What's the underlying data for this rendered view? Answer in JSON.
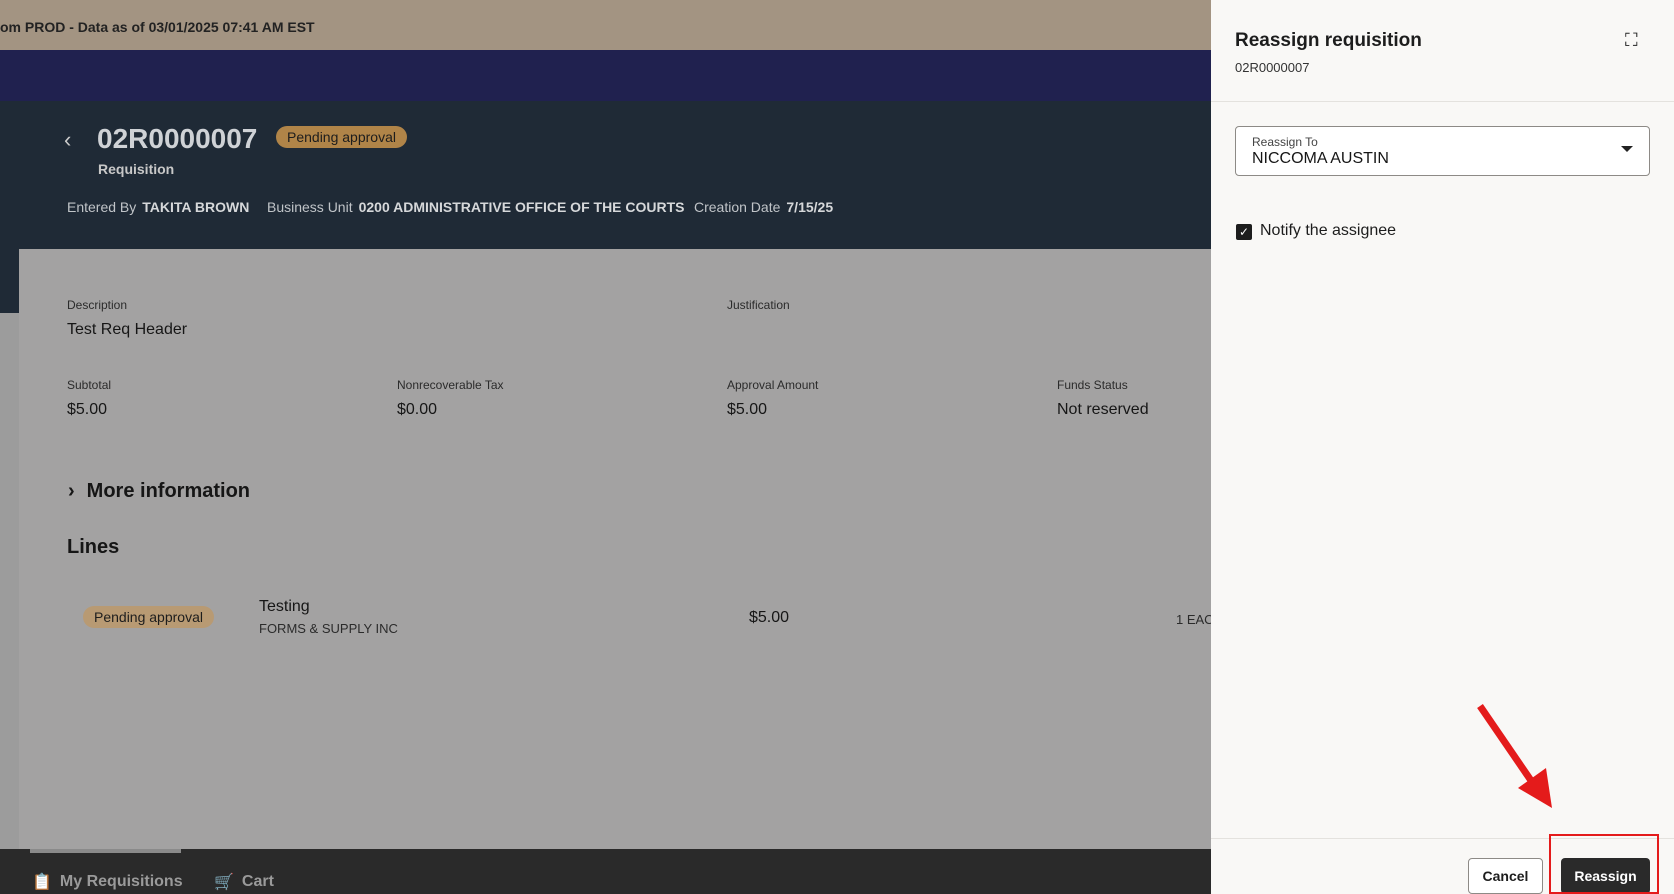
{
  "banner": {
    "text": "om PROD - Data as of 03/01/2025 07:41 AM EST"
  },
  "header": {
    "req_id": "02R0000007",
    "status": "Pending approval",
    "subtitle": "Requisition",
    "entered_by_label": "Entered By",
    "entered_by": "TAKITA BROWN",
    "business_unit_label": "Business Unit",
    "business_unit": "0200 ADMINISTRATIVE OFFICE OF THE COURTS",
    "creation_date_label": "Creation Date",
    "creation_date": "7/15/25"
  },
  "details": {
    "description_label": "Description",
    "description": "Test Req Header",
    "justification_label": "Justification",
    "fields": [
      {
        "label": "Subtotal",
        "value": "$5.00"
      },
      {
        "label": "Nonrecoverable Tax",
        "value": "$0.00"
      },
      {
        "label": "Approval Amount",
        "value": "$5.00"
      },
      {
        "label": "Funds Status",
        "value": "Not reserved"
      }
    ],
    "more_info": "More information",
    "lines_title": "Lines",
    "line": {
      "status": "Pending approval",
      "item": "Testing",
      "supplier": "FORMS & SUPPLY INC",
      "amount": "$5.00",
      "qty": "1 EAC"
    }
  },
  "bottom_nav": {
    "tabs": [
      "My Requisitions",
      "Cart"
    ]
  },
  "panel": {
    "title": "Reassign requisition",
    "subtitle": "02R0000007",
    "reassign_to_label": "Reassign To",
    "reassign_to": "NICCOMA AUSTIN",
    "notify_label": "Notify the assignee",
    "notify_checked": true,
    "cancel": "Cancel",
    "reassign": "Reassign"
  },
  "colors": {
    "annotation": "#e41b1b"
  }
}
